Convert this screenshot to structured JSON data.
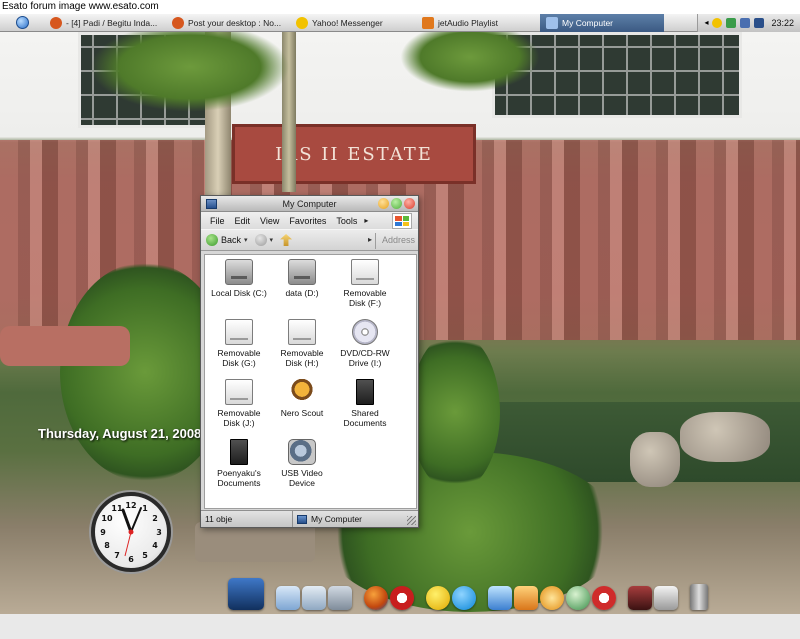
{
  "watermark": "Esato forum image www.esato.com",
  "taskbar": {
    "tasks": [
      {
        "label": "- [4] Padi / Begitu Inda...",
        "icon": "firefox-icon",
        "color": "#d6571e"
      },
      {
        "label": "Post your desktop : No...",
        "icon": "firefox-icon",
        "color": "#d6571e"
      },
      {
        "label": "Yahoo! Messenger",
        "icon": "yahoo-messenger-icon",
        "color": "#f2c200"
      },
      {
        "label": "jetAudio Playlist",
        "icon": "jetaudio-icon",
        "color": "#e0781c"
      },
      {
        "label": "My Computer",
        "icon": "my-computer-icon",
        "color": "#3b6fb5",
        "active": true
      }
    ],
    "clock": "23:22"
  },
  "desktop": {
    "date_overlay": "Thursday, August 21, 2008",
    "sign_text": "IAS II ESTATE"
  },
  "window": {
    "title": "My Computer",
    "menu": [
      "File",
      "Edit",
      "View",
      "Favorites",
      "Tools"
    ],
    "toolbar": {
      "back_label": "Back",
      "address_label": "Address"
    },
    "items": [
      {
        "label": "Local Disk (C:)",
        "kind": "drive"
      },
      {
        "label": "data (D:)",
        "kind": "drive"
      },
      {
        "label": "Removable Disk (F:)",
        "kind": "removable"
      },
      {
        "label": "Removable Disk (G:)",
        "kind": "removable"
      },
      {
        "label": "Removable Disk (H:)",
        "kind": "removable"
      },
      {
        "label": "DVD/CD-RW Drive (I:)",
        "kind": "cd"
      },
      {
        "label": "Removable Disk (J:)",
        "kind": "removable"
      },
      {
        "label": "Nero Scout",
        "kind": "nero"
      },
      {
        "label": "Shared Documents",
        "kind": "docs"
      },
      {
        "label": "Poenyaku's Documents",
        "kind": "docs"
      },
      {
        "label": "USB Video Device",
        "kind": "usb"
      }
    ],
    "status": {
      "count": "11 obje",
      "location": "My Computer"
    }
  },
  "colors": {
    "taskbar_active": "#4b6d98",
    "window_chrome": "#d7d7d7",
    "close_red": "#d93b2b",
    "max_green": "#4fae3b",
    "min_orange": "#e6a11b"
  }
}
